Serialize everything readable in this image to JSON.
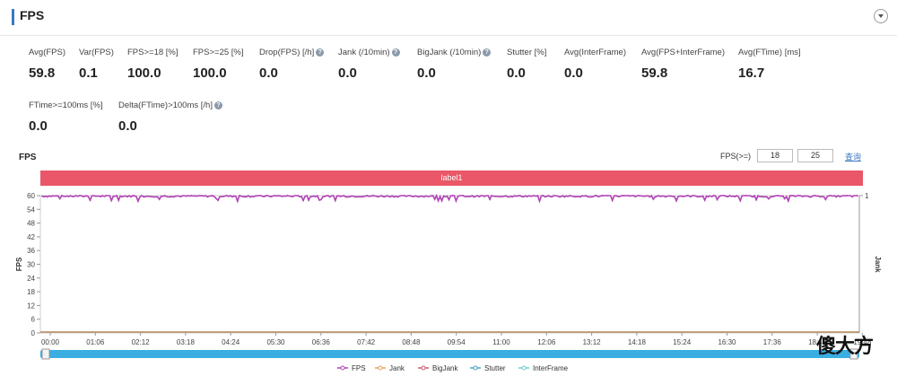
{
  "header": {
    "title": "FPS"
  },
  "metrics_row1": [
    {
      "label": "Avg(FPS)",
      "value": "59.8",
      "help": false
    },
    {
      "label": "Var(FPS)",
      "value": "0.1",
      "help": false
    },
    {
      "label": "FPS>=18 [%]",
      "value": "100.0",
      "help": false
    },
    {
      "label": "FPS>=25 [%]",
      "value": "100.0",
      "help": false
    },
    {
      "label": "Drop(FPS) [/h]",
      "value": "0.0",
      "help": true
    },
    {
      "label": "Jank (/10min)",
      "value": "0.0",
      "help": true
    },
    {
      "label": "BigJank (/10min)",
      "value": "0.0",
      "help": true
    },
    {
      "label": "Stutter [%]",
      "value": "0.0",
      "help": false
    },
    {
      "label": "Avg(InterFrame)",
      "value": "0.0",
      "help": false
    },
    {
      "label": "Avg(FPS+InterFrame)",
      "value": "59.8",
      "help": false
    },
    {
      "label": "Avg(FTime) [ms]",
      "value": "16.7",
      "help": false
    }
  ],
  "metrics_row2": [
    {
      "label": "FTime>=100ms [%]",
      "value": "0.0",
      "help": false
    },
    {
      "label": "Delta(FTime)>100ms [/h]",
      "value": "0.0",
      "help": true
    }
  ],
  "chart_controls": {
    "title": "FPS",
    "filter_label": "FPS(>=)",
    "threshold_1": "18",
    "threshold_2": "25",
    "query_label": "查询"
  },
  "label_bar": {
    "text": "label1",
    "color": "#e95768"
  },
  "watermark": "傻大方",
  "chart_data": {
    "type": "line",
    "title": "",
    "ylabel": "FPS",
    "y2label": "Jank",
    "ylim": [
      0,
      60
    ],
    "y2lim": [
      0,
      1
    ],
    "yticks": [
      0,
      6,
      12,
      18,
      24,
      30,
      36,
      42,
      48,
      54,
      60
    ],
    "y2ticks": [
      1
    ],
    "xticks": [
      "00:00",
      "01:06",
      "02:12",
      "03:18",
      "04:24",
      "05:30",
      "06:36",
      "07:42",
      "08:48",
      "09:54",
      "11:00",
      "12:06",
      "13:12",
      "14:18",
      "15:24",
      "16:30",
      "17:36",
      "18:42",
      "19:48"
    ],
    "x_range_minutes": [
      0,
      1342
    ],
    "grid": false,
    "legend_position": "bottom",
    "series": [
      {
        "name": "FPS",
        "color": "#b043b5",
        "axis": "left",
        "baseline": 59.8,
        "min": 57.5,
        "max": 60
      },
      {
        "name": "Jank",
        "color": "#e8a15a",
        "axis": "right",
        "constant": 0
      },
      {
        "name": "BigJank",
        "color": "#c95a6e",
        "axis": "right",
        "constant": 0
      },
      {
        "name": "Stutter",
        "color": "#4aa3c5",
        "axis": "right",
        "constant": 0
      },
      {
        "name": "InterFrame",
        "color": "#6fcfd0",
        "axis": "right",
        "constant": 0
      }
    ]
  }
}
